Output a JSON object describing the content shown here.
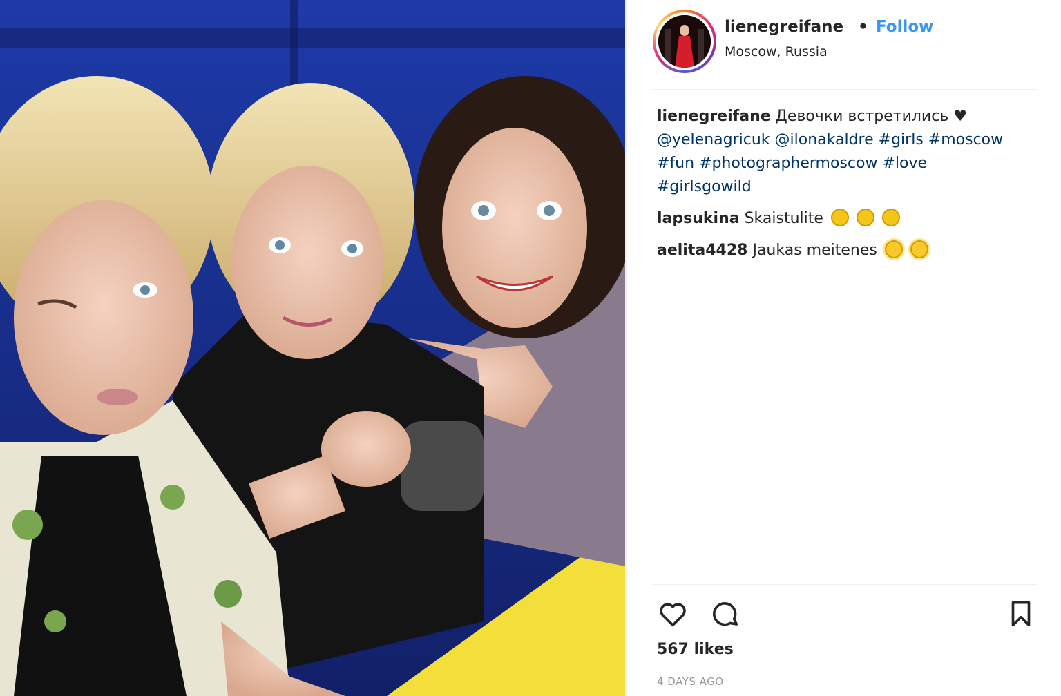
{
  "post": {
    "username": "lienegreifane",
    "separator": "•",
    "follow_label": "Follow",
    "location": "Moscow, Russia",
    "caption": {
      "user": "lienegreifane",
      "text": "Девочки встретились",
      "heart": "♥",
      "mentions": [
        "@yelenagricuk",
        "@ilonakaldre"
      ],
      "hashtags": [
        "#girls",
        "#moscow",
        "#fun",
        "#photographermoscow",
        "#love",
        "#girlsgowild"
      ]
    },
    "comments": [
      {
        "user": "lapsukina",
        "text": "Skaistulite",
        "emoji_icon": "crying-laughing-emoji-icon",
        "emoji_count": 3
      },
      {
        "user": "aelita4428",
        "text": "Jaukas meitenes",
        "emoji_icon": "sun-face-emoji-icon",
        "emoji_count": 2
      }
    ],
    "likes": "567 likes",
    "timestamp": "4 DAYS AGO"
  },
  "icons": {
    "like": "heart-icon",
    "comment": "comment-icon",
    "save": "bookmark-icon"
  },
  "colors": {
    "accent": "#3897f0",
    "link": "#003569",
    "text": "#262626",
    "muted": "#999999"
  }
}
